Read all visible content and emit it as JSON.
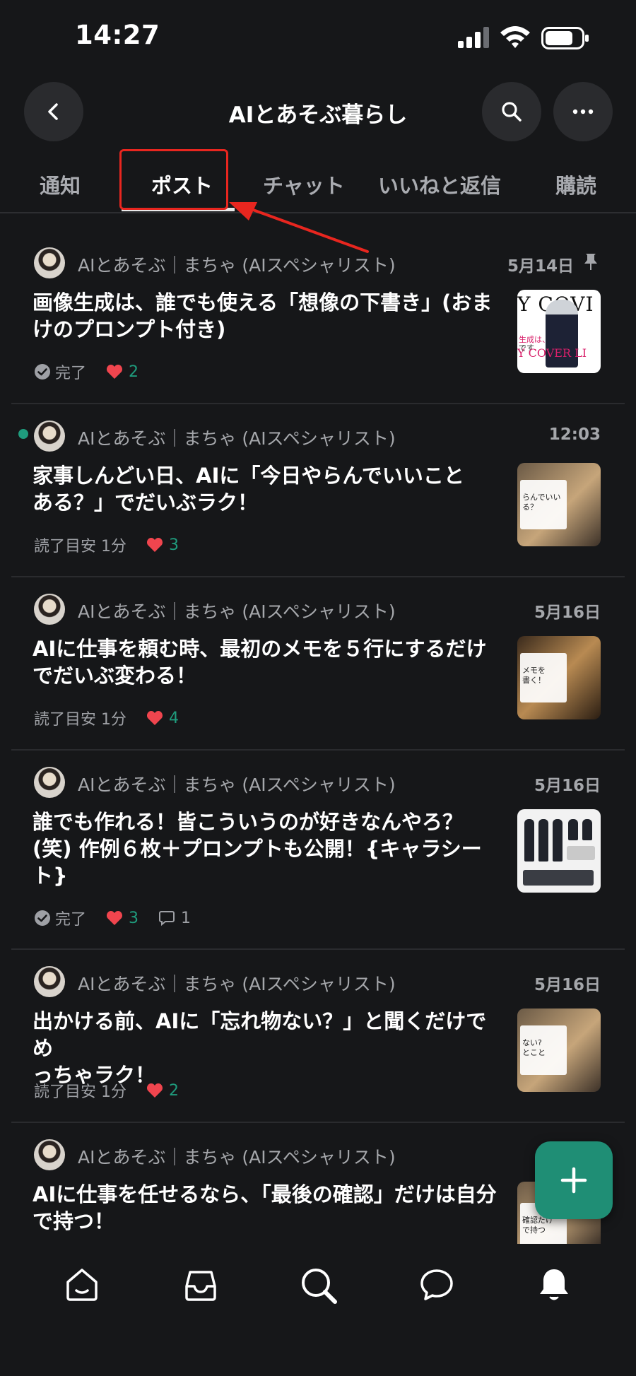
{
  "status_bar": {
    "time": "14:27"
  },
  "header": {
    "title": "AIとあそぶ暮らし",
    "back_icon": "chevron-left-icon",
    "search_icon": "search-icon",
    "more_icon": "more-horizontal-icon"
  },
  "tabs": [
    {
      "label": "通知",
      "active": false
    },
    {
      "label": "ポスト",
      "active": true
    },
    {
      "label": "チャット",
      "active": false
    },
    {
      "label": "いいねと返信",
      "active": false
    },
    {
      "label": "購読",
      "active": false
    }
  ],
  "colors": {
    "background": "#161719",
    "accent": "#1f9c7d",
    "like": "#f0454e",
    "annotation": "#e8261f",
    "fab": "#1f8e75"
  },
  "posts": [
    {
      "author": "AIとあそぶ｜まちゃ (AIスペシャリスト)",
      "date": "5月14日",
      "pinned": true,
      "title_lines": [
        "画像生成は、誰でも使える「想像の下書き」(おま",
        "けのプロンプト付き)"
      ],
      "meta_label": "完了",
      "meta_type": "done",
      "likes": "2",
      "thumb_text": [
        "Y COVI",
        "生成は、",
        "です",
        "Y COVER LI"
      ]
    },
    {
      "author": "AIとあそぶ｜まちゃ (AIスペシャリスト)",
      "date": "12:03",
      "unread": true,
      "title_lines": [
        "家事しんどい日、AIに「今日やらんでいいこと",
        "ある？」でだいぶラク！"
      ],
      "meta_label": "読了目安 1分",
      "meta_type": "read",
      "likes": "3",
      "thumb_text": [
        "らんでいい",
        "る？"
      ]
    },
    {
      "author": "AIとあそぶ｜まちゃ (AIスペシャリスト)",
      "date": "5月16日",
      "title_lines": [
        "AIに仕事を頼む時、最初のメモを５行にするだけ",
        "でだいぶ変わる！"
      ],
      "meta_label": "読了目安 1分",
      "meta_type": "read",
      "likes": "4",
      "thumb_text": [
        "メモを",
        "書く！"
      ]
    },
    {
      "author": "AIとあそぶ｜まちゃ (AIスペシャリスト)",
      "date": "5月16日",
      "title_lines": [
        "誰でも作れる！皆こういうのが好きなんやろ？",
        "(笑) 作例６枚＋プロンプトも公開！{キャラシー",
        "ト}"
      ],
      "meta_label": "完了",
      "meta_type": "done",
      "likes": "3",
      "comments": "1"
    },
    {
      "author": "AIとあそぶ｜まちゃ (AIスペシャリスト)",
      "date": "5月16日",
      "title_lines": [
        "出かける前、AIに「忘れ物ない？」と聞くだけでめ",
        "っちゃラク！"
      ],
      "meta_label": "読了目安 1分",
      "meta_type": "read",
      "likes": "2",
      "thumb_text": [
        "ない?",
        "とこと"
      ]
    },
    {
      "author": "AIとあそぶ｜まちゃ (AIスペシャリスト)",
      "date": "",
      "title_lines": [
        "AIに仕事を任せるなら、「最後の確認」だけは自分",
        "で持つ！"
      ],
      "thumb_text": [
        "確認だけ",
        "で持つ"
      ]
    }
  ],
  "fab": {
    "icon": "plus-icon"
  },
  "bottom_nav": [
    {
      "icon": "home-icon"
    },
    {
      "icon": "inbox-icon"
    },
    {
      "icon": "search-icon"
    },
    {
      "icon": "chat-icon"
    },
    {
      "icon": "bell-icon"
    }
  ]
}
